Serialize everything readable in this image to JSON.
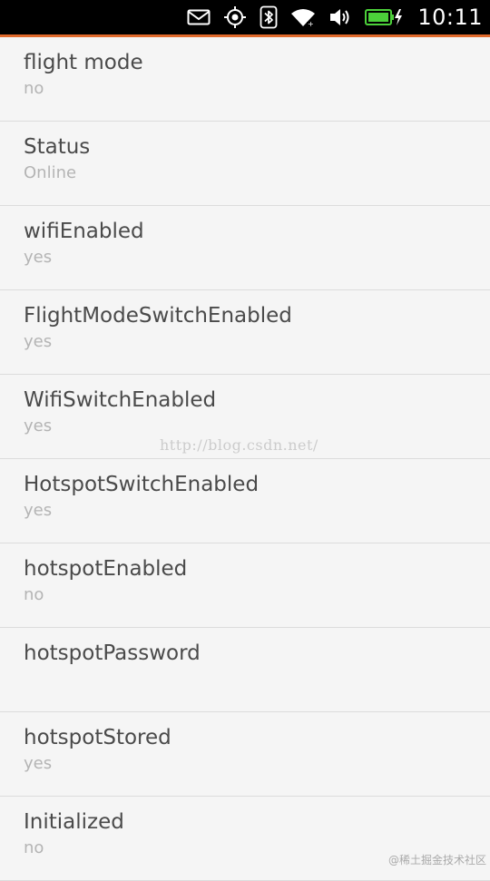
{
  "status_bar": {
    "time": "10:11",
    "icons": [
      "mail-icon",
      "gps-icon",
      "bluetooth-icon",
      "wifi-icon",
      "volume-icon",
      "battery-charging-icon"
    ]
  },
  "settings": [
    {
      "title": "flight mode",
      "value": "no"
    },
    {
      "title": "Status",
      "value": "Online"
    },
    {
      "title": "wifiEnabled",
      "value": "yes"
    },
    {
      "title": "FlightModeSwitchEnabled",
      "value": "yes"
    },
    {
      "title": "WifiSwitchEnabled",
      "value": "yes"
    },
    {
      "title": "HotspotSwitchEnabled",
      "value": "yes"
    },
    {
      "title": "hotspotEnabled",
      "value": "no"
    },
    {
      "title": "hotspotPassword",
      "value": ""
    },
    {
      "title": "hotspotStored",
      "value": "yes"
    },
    {
      "title": "Initialized",
      "value": "no"
    }
  ],
  "watermark": "http://blog.csdn.net/",
  "corner_mark": "@稀土掘金技术社区",
  "colors": {
    "accent": "#e06a2c",
    "battery": "#4cd13a"
  }
}
